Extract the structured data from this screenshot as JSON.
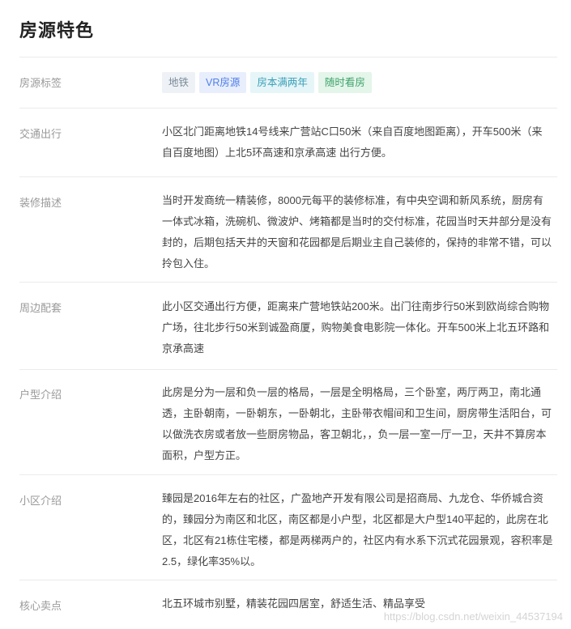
{
  "section": {
    "title": "房源特色"
  },
  "tags": {
    "label": "房源标签",
    "items": [
      {
        "text": "地铁",
        "color": "#7a8a99",
        "bg": "#eef2f6"
      },
      {
        "text": "VR房源",
        "color": "#4f7ee8",
        "bg": "#e8eefc"
      },
      {
        "text": "房本满两年",
        "color": "#3aa0b8",
        "bg": "#e6f5f8"
      },
      {
        "text": "随时看房",
        "color": "#3ea36b",
        "bg": "#e4f5ea"
      }
    ]
  },
  "rows": [
    {
      "label": "交通出行",
      "lines": [
        "小区北门距离地铁14号线来广营站C口50米（来自百度地图距离），开车500米（来",
        "自百度地图）上北5环高速和京承高速 出行方便。"
      ]
    },
    {
      "label": "装修描述",
      "lines": [
        "当时开发商统一精装修，8000元每平的装修标准，有中央空调和新风系统，厨房有",
        "一体式冰箱，洗碗机、微波炉、烤箱都是当时的交付标准，花园当时天井部分是没有",
        "封的，后期包括天井的天窗和花园都是后期业主自己装修的，保持的非常不错，可以",
        "拎包入住。"
      ]
    },
    {
      "label": "周边配套",
      "lines": [
        "此小区交通出行方便，距离来广营地铁站200米。出门往南步行50米到欧尚综合购物",
        "广场，往北步行50米到诚盈商厦，购物美食电影院一体化。开车500米上北五环路和",
        "京承高速"
      ]
    },
    {
      "label": "户型介绍",
      "lines": [
        "此房是分为一层和负一层的格局，一层是全明格局，三个卧室，两厅两卫，南北通",
        "透，主卧朝南，一卧朝东，一卧朝北，主卧带衣帽间和卫生间，厨房带生活阳台，可",
        "以做洗衣房或者放一些厨房物品，客卫朝北，，负一层一室一厅一卫，天井不算房本",
        "面积，户型方正。"
      ]
    },
    {
      "label": "小区介绍",
      "lines": [
        "臻园是2016年左右的社区，广盈地产开发有限公司是招商局、九龙仓、华侨城合资",
        "的，臻园分为南区和北区，南区都是小户型，北区都是大户型140平起的，此房在北",
        "区，北区有21栋住宅楼，都是两梯两户的，社区内有水系下沉式花园景观，容积率是",
        "2.5，绿化率35%以。"
      ]
    },
    {
      "label": "核心卖点",
      "lines": [
        "北五环城市别墅，精装花园四居室，舒适生活、精品享受"
      ]
    }
  ],
  "watermark": "https://blog.csdn.net/weixin_44537194"
}
